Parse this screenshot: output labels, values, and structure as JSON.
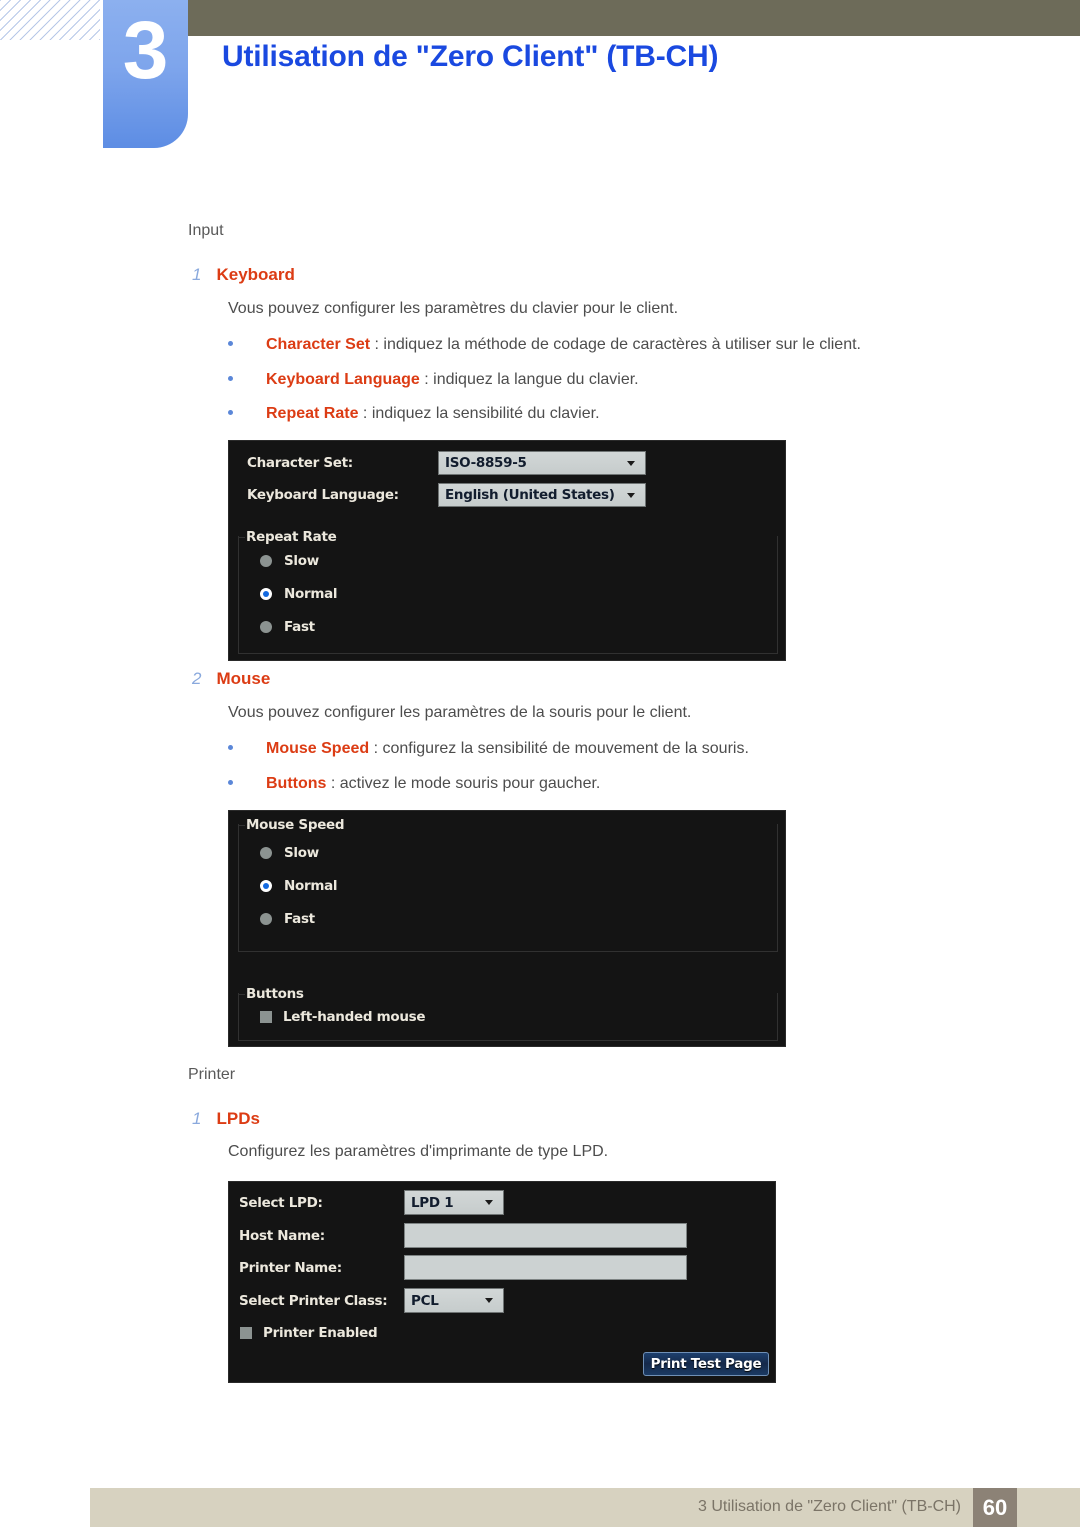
{
  "header": {
    "chapter_number": "3",
    "title": "Utilisation de \"Zero Client\" (TB-CH)"
  },
  "sections": [
    {
      "heading": "Input",
      "items": [
        {
          "number": "1",
          "label": "Keyboard",
          "description": "Vous pouvez configurer les paramètres du clavier pour le client.",
          "bullets": [
            {
              "term": "Character Set",
              "rest": " : indiquez la méthode de codage de caractères à utiliser sur le client."
            },
            {
              "term": "Keyboard Language",
              "rest": " : indiquez la langue du clavier."
            },
            {
              "term": "Repeat Rate",
              "rest": " : indiquez la sensibilité du clavier."
            }
          ]
        },
        {
          "number": "2",
          "label": "Mouse",
          "description": "Vous pouvez configurer les paramètres de la souris pour le client.",
          "bullets": [
            {
              "term": "Mouse Speed",
              "rest": " : configurez la sensibilité de mouvement de la souris."
            },
            {
              "term": "Buttons",
              "rest": " : activez le mode souris pour gaucher."
            }
          ]
        }
      ]
    },
    {
      "heading": "Printer",
      "items": [
        {
          "number": "1",
          "label": "LPDs",
          "description": "Configurez les paramètres d'imprimante de type LPD.",
          "bullets": []
        }
      ]
    }
  ],
  "keyboard_panel": {
    "character_set_label": "Character Set:",
    "character_set_value": "ISO-8859-5",
    "keyboard_language_label": "Keyboard Language:",
    "keyboard_language_value": "English (United States)",
    "repeat_rate_group": "Repeat Rate",
    "repeat_rate_options": [
      "Slow",
      "Normal",
      "Fast"
    ],
    "repeat_rate_selected": "Normal"
  },
  "mouse_panel": {
    "mouse_speed_group": "Mouse Speed",
    "mouse_speed_options": [
      "Slow",
      "Normal",
      "Fast"
    ],
    "mouse_speed_selected": "Normal",
    "buttons_group": "Buttons",
    "left_handed_label": "Left-handed mouse",
    "left_handed_checked": false
  },
  "printer_panel": {
    "select_lpd_label": "Select LPD:",
    "select_lpd_value": "LPD 1",
    "host_name_label": "Host Name:",
    "host_name_value": "",
    "printer_name_label": "Printer Name:",
    "printer_name_value": "",
    "printer_class_label": "Select Printer Class:",
    "printer_class_value": "PCL",
    "printer_enabled_label": "Printer Enabled",
    "printer_enabled_checked": false,
    "print_test_page_label": "Print Test Page"
  },
  "footer": {
    "text": "3 Utilisation de \"Zero Client\" (TB-CH)",
    "page_number": "60"
  },
  "colors": {
    "title_blue": "#1a49e0",
    "term_orange": "#dc3c14",
    "number_blue": "#8aa9dd",
    "olive": "#6d6b59",
    "footer_beige": "#d7d2c0",
    "page_box": "#8c8276",
    "panel_bg": "#141414"
  }
}
